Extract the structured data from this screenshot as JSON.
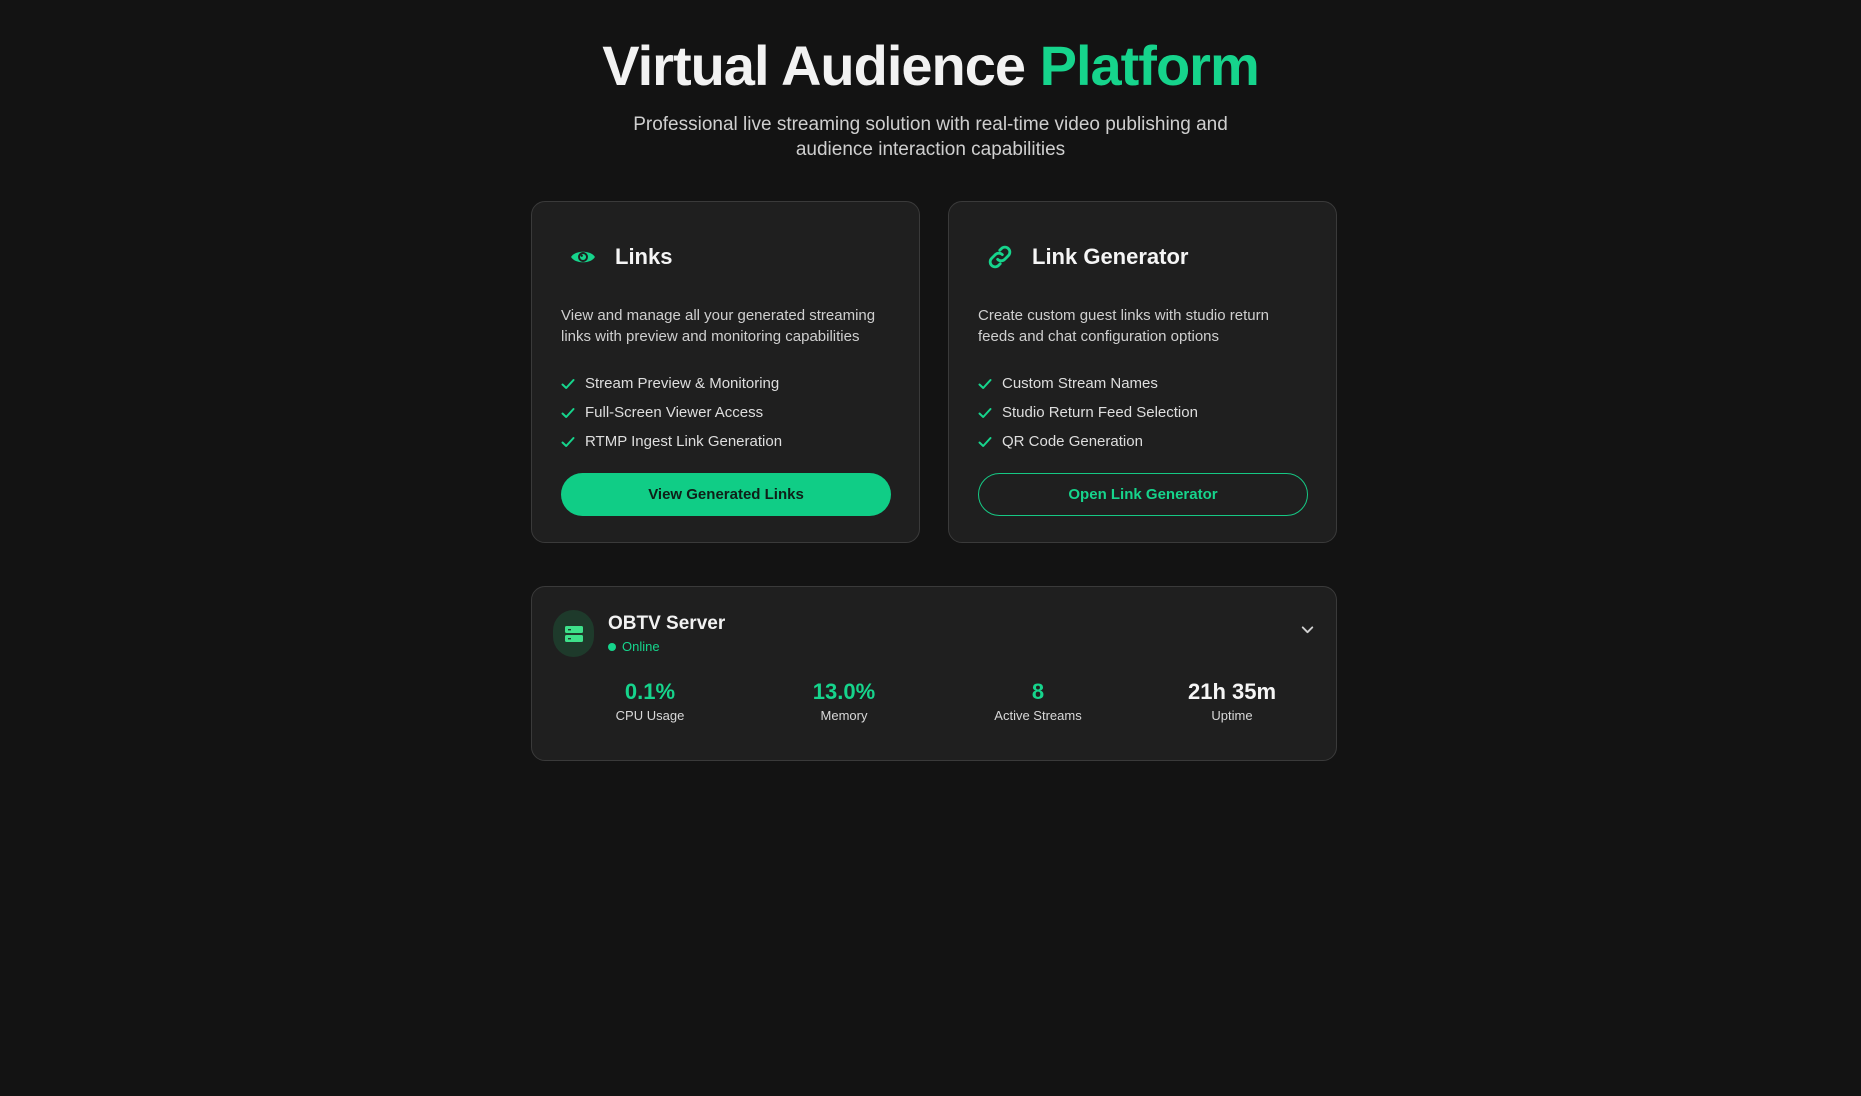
{
  "hero": {
    "title_main": "Virtual Audience ",
    "title_accent": "Platform",
    "subtitle": "Professional live streaming solution with real-time video publishing and audience interaction capabilities"
  },
  "cards": [
    {
      "icon": "eye-icon",
      "title": "Links",
      "description": "View and manage all your generated streaming links with preview and monitoring capabilities",
      "features": [
        "Stream Preview & Monitoring",
        "Full-Screen Viewer Access",
        "RTMP Ingest Link Generation"
      ],
      "button_label": "View Generated Links"
    },
    {
      "icon": "link-icon",
      "title": "Link Generator",
      "description": "Create custom guest links with studio return feeds and chat configuration options",
      "features": [
        "Custom Stream Names",
        "Studio Return Feed Selection",
        "QR Code Generation"
      ],
      "button_label": "Open Link Generator"
    }
  ],
  "server": {
    "icon": "server-icon",
    "name": "OBTV Server",
    "status": "Online",
    "stats": [
      {
        "value": "0.1%",
        "label": "CPU Usage"
      },
      {
        "value": "13.0%",
        "label": "Memory"
      },
      {
        "value": "8",
        "label": "Active Streams"
      },
      {
        "value": "21h 35m",
        "label": "Uptime"
      }
    ]
  },
  "colors": {
    "background": "#131313",
    "card": "#1f1f1f",
    "accent": "#16d48c"
  }
}
